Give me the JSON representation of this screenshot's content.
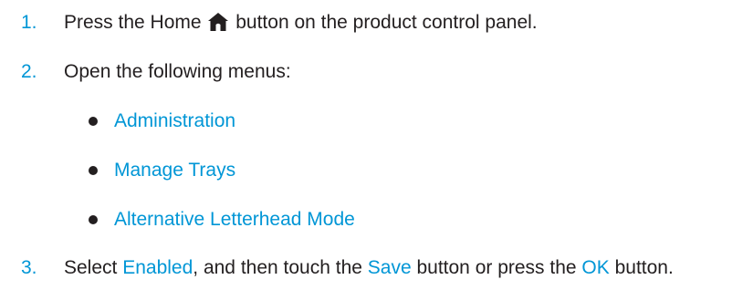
{
  "steps": [
    {
      "number": "1.",
      "before_icon": "Press the Home ",
      "icon": "home-icon",
      "after_icon": " button on the product control panel."
    },
    {
      "number": "2.",
      "text": "Open the following menus:"
    },
    {
      "number": "3.",
      "part1": "Select ",
      "highlight1": "Enabled",
      "part2": ", and then touch the ",
      "highlight2": "Save",
      "part3": " button or press the ",
      "highlight3": "OK",
      "part4": " button."
    }
  ],
  "menus": [
    "Administration",
    "Manage Trays",
    "Alternative Letterhead Mode"
  ],
  "colors": {
    "accent": "#0096d6",
    "text": "#231f20"
  }
}
